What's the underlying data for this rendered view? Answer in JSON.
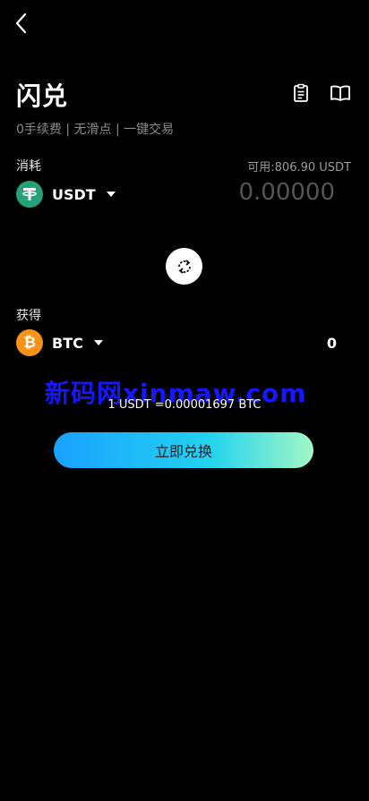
{
  "header": {
    "title": "闪兑",
    "subtitle": "0手续费 | 无滑点 | 一键交易"
  },
  "pay": {
    "label": "消耗",
    "available": "可用:806.90 USDT",
    "token": "USDT",
    "amount_placeholder": "0.00000"
  },
  "receive": {
    "label": "获得",
    "token": "BTC",
    "amount": "0"
  },
  "watermark": "新码网xinmaw.com",
  "rate": "1 USDT =0.00001697 BTC",
  "exchange_button": "立即兑换",
  "icons": {
    "back": "chevron-left-icon",
    "orders": "clipboard-icon",
    "guide": "book-open-icon",
    "swap": "swap-arrows-icon"
  },
  "colors": {
    "background": "#000000",
    "usdt": "#26a17b",
    "btc": "#f7931a",
    "button_gradient_start": "#1aa1ff",
    "button_gradient_end": "#a3f7c5",
    "watermark": "#1616ff"
  }
}
